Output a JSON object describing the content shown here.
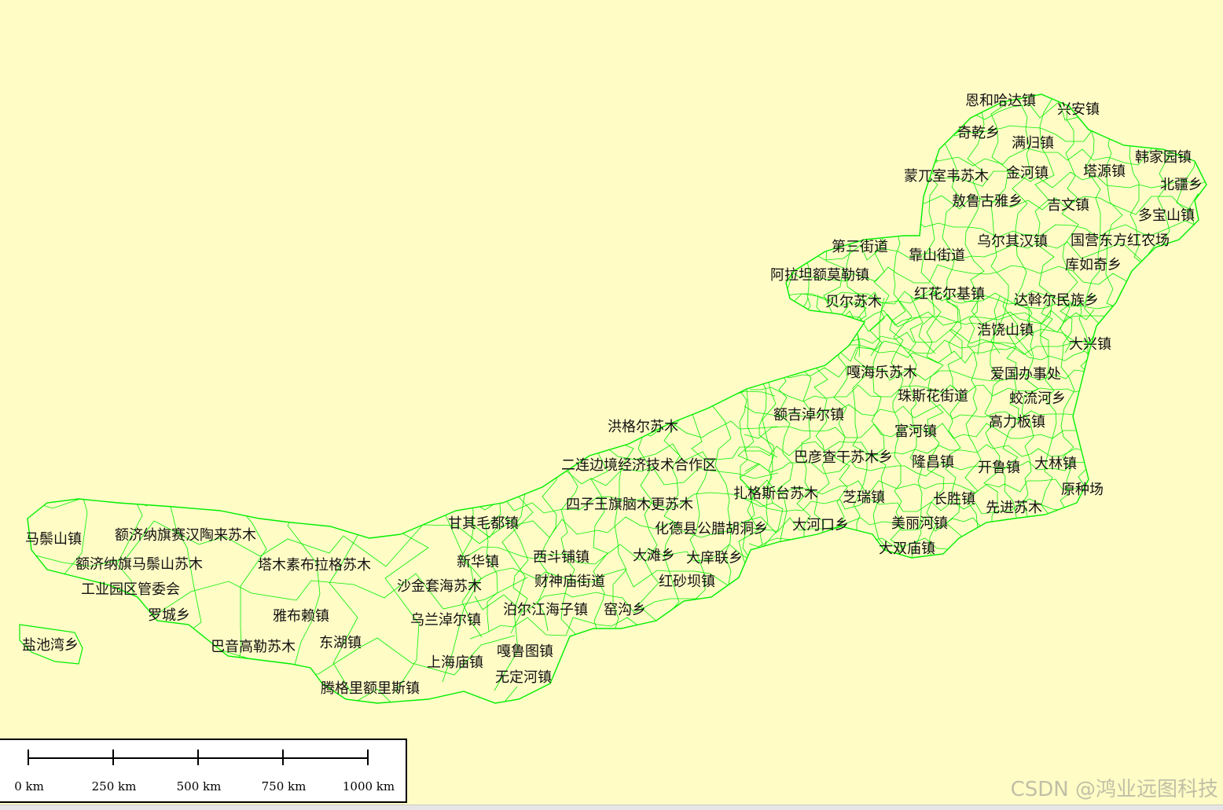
{
  "map": {
    "boundary_color": "#00ee00",
    "background_color": "#fffcc6",
    "labels": [
      "恩和哈达镇",
      "兴安镇",
      "奇乾乡",
      "满归镇",
      "韩家园镇",
      "蒙兀室韦苏木",
      "金河镇",
      "塔源镇",
      "北疆乡",
      "敖鲁古雅乡",
      "吉文镇",
      "多宝山镇",
      "第三街道",
      "靠山街道",
      "乌尔其汉镇",
      "国营东方红农场",
      "库如奇乡",
      "阿拉坦额莫勒镇",
      "红花尔基镇",
      "贝尔苏木",
      "达斡尔民族乡",
      "浩饶山镇",
      "大兴镇",
      "嘎海乐苏木",
      "爱国办事处",
      "珠斯花街道",
      "蛟流河乡",
      "额吉淖尔镇",
      "高力板镇",
      "洪格尔苏木",
      "富河镇",
      "巴彦查干苏木乡",
      "隆昌镇",
      "开鲁镇",
      "大林镇",
      "二连边境经济技术合作区",
      "扎格斯台苏木",
      "芝瑞镇",
      "长胜镇",
      "原种场",
      "先进苏木",
      "四子王旗脑木更苏木",
      "甘其毛都镇",
      "化德县公腊胡洞乡",
      "大河口乡",
      "美丽河镇",
      "大双庙镇",
      "马鬃山镇",
      "额济纳旗赛汉陶来苏木",
      "大滩乡",
      "大庠联乡",
      "额济纳旗马鬃山苏木",
      "塔木素布拉格苏木",
      "新华镇",
      "西斗铺镇",
      "财神庙街道",
      "红砂坝镇",
      "沙金套海苏木",
      "工业园区管委会",
      "罗城乡",
      "雅布赖镇",
      "乌兰淖尔镇",
      "泊尔江海子镇",
      "窑沟乡",
      "盐池湾乡",
      "巴音高勒苏木",
      "东湖镇",
      "上海庙镇",
      "嘎鲁图镇",
      "无定河镇",
      "腾格里额里斯镇"
    ]
  },
  "scale_bar": {
    "labels": [
      "0 km",
      "250 km",
      "500 km",
      "750 km",
      "1000 km"
    ]
  },
  "watermark": "CSDN @鸿业远图科技"
}
